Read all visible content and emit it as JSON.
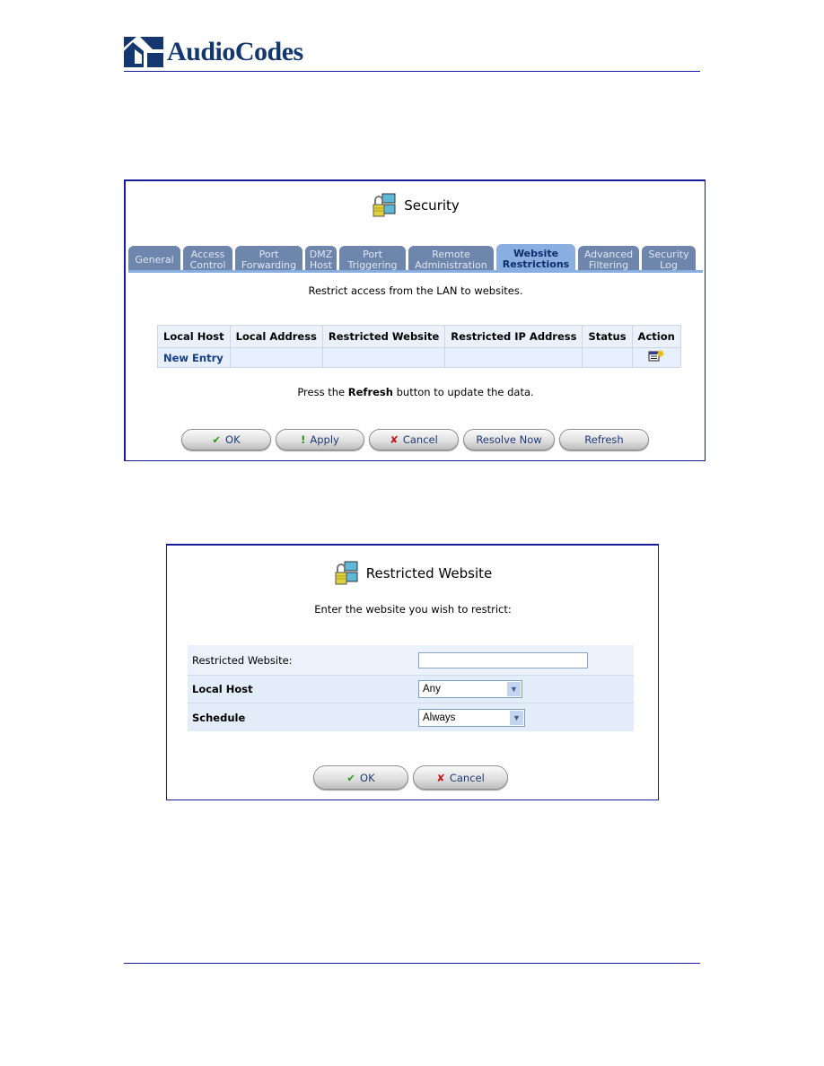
{
  "header": {
    "brand": "AudioCodes",
    "brand_color": "#13376e"
  },
  "security_panel": {
    "title": "Security",
    "tabs": [
      {
        "line1": "General",
        "line2": "",
        "active": false
      },
      {
        "line1": "Access",
        "line2": "Control",
        "active": false
      },
      {
        "line1": "Port",
        "line2": "Forwarding",
        "active": false
      },
      {
        "line1": "DMZ",
        "line2": "Host",
        "active": false
      },
      {
        "line1": "Port",
        "line2": "Triggering",
        "active": false
      },
      {
        "line1": "Remote",
        "line2": "Administration",
        "active": false
      },
      {
        "line1": "Website",
        "line2": "Restrictions",
        "active": true
      },
      {
        "line1": "Advanced",
        "line2": "Filtering",
        "active": false
      },
      {
        "line1": "Security",
        "line2": "Log",
        "active": false
      }
    ],
    "description": "Restrict access from the LAN to websites.",
    "table": {
      "columns": [
        "Local Host",
        "Local Address",
        "Restricted Website",
        "Restricted IP Address",
        "Status",
        "Action"
      ],
      "rows": [
        {
          "local_host": "New Entry",
          "local_address": "",
          "restricted_website": "",
          "restricted_ip": "",
          "status": "",
          "action_icon": "new-entry-icon"
        }
      ]
    },
    "refresh_note": {
      "before": "Press the ",
      "bold": "Refresh",
      "after": " button to update the data."
    },
    "buttons": {
      "ok": "OK",
      "apply": "Apply",
      "cancel": "Cancel",
      "resolve": "Resolve Now",
      "refresh": "Refresh"
    }
  },
  "restricted_panel": {
    "title": "Restricted Website",
    "instruction": "Enter the website you wish to restrict:",
    "fields": {
      "website_label": "Restricted Website:",
      "website_value": "",
      "local_host_label": "Local Host",
      "local_host_value": "Any",
      "schedule_label": "Schedule",
      "schedule_value": "Always"
    },
    "buttons": {
      "ok": "OK",
      "cancel": "Cancel"
    }
  },
  "icons": {
    "ok": "✔",
    "apply": "!",
    "cancel": "✘",
    "dropdown": "⌄"
  }
}
